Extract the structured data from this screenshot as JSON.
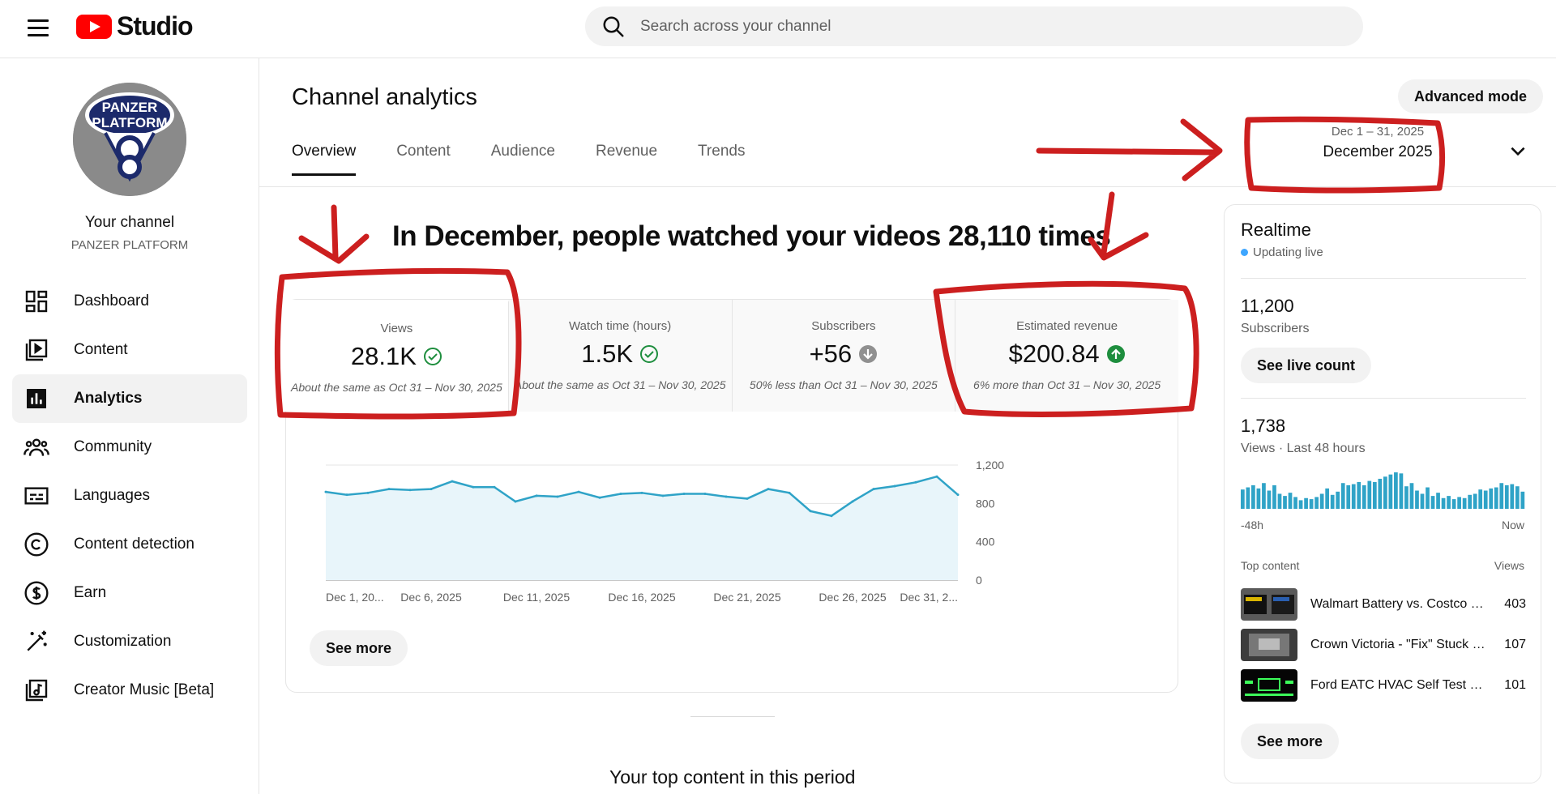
{
  "app": {
    "logo_text": "Studio"
  },
  "search": {
    "placeholder": "Search across your channel"
  },
  "channel": {
    "title": "Your channel",
    "handle": "PANZER PLATFORM",
    "avatar_text_1": "PANZER",
    "avatar_text_2": "PLATFORM"
  },
  "sidebar": {
    "items": [
      {
        "label": "Dashboard",
        "icon": "dashboard-icon"
      },
      {
        "label": "Content",
        "icon": "content-icon"
      },
      {
        "label": "Analytics",
        "icon": "analytics-icon",
        "active": true
      },
      {
        "label": "Community",
        "icon": "community-icon"
      },
      {
        "label": "Languages",
        "icon": "languages-icon"
      },
      {
        "label": "Content detection",
        "icon": "copyright-icon"
      },
      {
        "label": "Earn",
        "icon": "earn-icon"
      },
      {
        "label": "Customization",
        "icon": "customization-icon"
      },
      {
        "label": "Creator Music [Beta]",
        "icon": "creator-music-icon"
      }
    ]
  },
  "header": {
    "title": "Channel analytics",
    "advanced_mode": "Advanced mode",
    "tabs": [
      "Overview",
      "Content",
      "Audience",
      "Revenue",
      "Trends"
    ],
    "date_range": "Dec 1 – 31, 2025",
    "date_label": "December 2025"
  },
  "overview": {
    "headline": "In December, people watched your videos 28,110 times",
    "metrics": [
      {
        "label": "Views",
        "value": "28.1K",
        "status": "check",
        "note": "About the same as Oct 31 – Nov 30, 2025"
      },
      {
        "label": "Watch time (hours)",
        "value": "1.5K",
        "status": "check",
        "note": "About the same as Oct 31 – Nov 30, 2025"
      },
      {
        "label": "Subscribers",
        "value": "+56",
        "status": "down",
        "note": "50% less than Oct 31 – Nov 30, 2025"
      },
      {
        "label": "Estimated revenue",
        "value": "$200.84",
        "status": "up",
        "note": "6% more than Oct 31 – Nov 30, 2025"
      }
    ],
    "see_more": "See more",
    "top_content_title": "Your top content in this period"
  },
  "chart_data": {
    "type": "area",
    "x": [
      "Dec 1",
      "Dec 2",
      "Dec 3",
      "Dec 4",
      "Dec 5",
      "Dec 6",
      "Dec 7",
      "Dec 8",
      "Dec 9",
      "Dec 10",
      "Dec 11",
      "Dec 12",
      "Dec 13",
      "Dec 14",
      "Dec 15",
      "Dec 16",
      "Dec 17",
      "Dec 18",
      "Dec 19",
      "Dec 20",
      "Dec 21",
      "Dec 22",
      "Dec 23",
      "Dec 24",
      "Dec 25",
      "Dec 26",
      "Dec 27",
      "Dec 28",
      "Dec 29",
      "Dec 30",
      "Dec 31"
    ],
    "values": [
      920,
      890,
      910,
      950,
      940,
      950,
      1030,
      970,
      970,
      820,
      880,
      870,
      920,
      860,
      900,
      910,
      880,
      900,
      900,
      870,
      850,
      950,
      910,
      720,
      670,
      820,
      950,
      980,
      1020,
      1080,
      890
    ],
    "x_tick_labels": [
      "Dec 1, 20...",
      "Dec 6, 2025",
      "Dec 11, 2025",
      "Dec 16, 2025",
      "Dec 21, 2025",
      "Dec 26, 2025",
      "Dec 31, 2..."
    ],
    "y_tick_labels": [
      "0",
      "400",
      "800",
      "1,200"
    ],
    "ylim": [
      0,
      1200
    ],
    "grid": true,
    "color": "#2fa3c7"
  },
  "realtime": {
    "title": "Realtime",
    "status": "Updating live",
    "subscribers_value": "11,200",
    "subscribers_label": "Subscribers",
    "see_live_count": "See live count",
    "views_value": "1,738",
    "views_label": "Views · Last 48 hours",
    "bars": [
      18,
      20,
      22,
      19,
      24,
      17,
      22,
      14,
      12,
      15,
      11,
      8,
      10,
      9,
      11,
      14,
      19,
      13,
      16,
      24,
      22,
      23,
      25,
      22,
      26,
      25,
      28,
      30,
      32,
      34,
      33,
      21,
      24,
      17,
      14,
      20,
      12,
      15,
      10,
      12,
      9,
      11,
      10,
      13,
      14,
      18,
      17,
      19,
      20,
      24,
      22,
      23,
      21,
      16
    ],
    "axis_left": "-48h",
    "axis_right": "Now",
    "top_content_label": "Top content",
    "views_column": "Views",
    "top_videos": [
      {
        "title": "Walmart Battery vs. Costco Battery",
        "views": "403"
      },
      {
        "title": "Crown Victoria - \"Fix\" Stuck Fuel Door",
        "views": "107"
      },
      {
        "title": "Ford EATC HVAC Self Test Diagnostics",
        "views": "101"
      }
    ],
    "see_more": "See more",
    "accent": "#3ea6ff"
  },
  "colors": {
    "annotation": "#cc1f1f",
    "check": "#1e8e3e",
    "down": "#909090",
    "brand": "#ff0000"
  }
}
